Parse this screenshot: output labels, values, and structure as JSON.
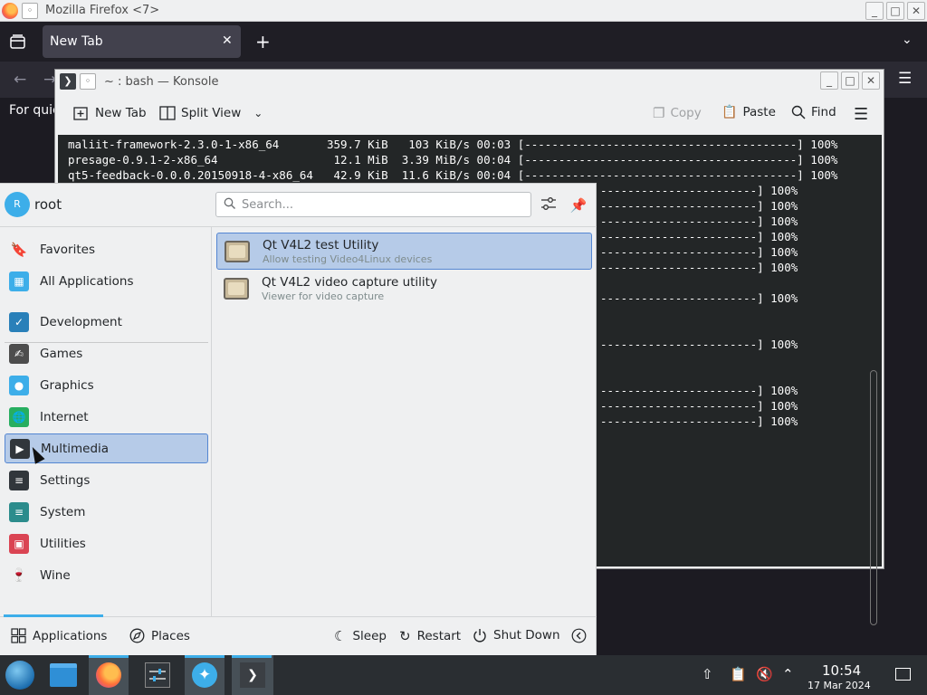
{
  "firefox": {
    "title": "Mozilla Firefox <7>",
    "tab_label": "New Tab",
    "quick_text": "For quic"
  },
  "konsole": {
    "title": "~ : bash — Konsole",
    "toolbar": {
      "new_tab": "New Tab",
      "split_view": "Split View",
      "copy": "Copy",
      "paste": "Paste",
      "find": "Find"
    },
    "lines": [
      "maliit-framework-2.3.0-1-x86_64       359.7 KiB   103 KiB/s 00:03 [----------------------------------------] 100%",
      "presage-0.9.1-2-x86_64                 12.1 MiB  3.39 MiB/s 00:04 [----------------------------------------] 100%",
      "qt5-feedback-0.0.0.20150918-4-x86_64   42.9 KiB  11.6 KiB/s 00:04 [----------------------------------------] 100%"
    ],
    "partial_lines": [
      {
        "row": 3,
        "text": "-----------------------] 100%"
      },
      {
        "row": 4,
        "text": "-----------------------] 100%"
      },
      {
        "row": 5,
        "text": "-----------------------] 100%"
      },
      {
        "row": 6,
        "text": "-----------------------] 100%"
      },
      {
        "row": 7,
        "text": "-----------------------] 100%"
      },
      {
        "row": 8,
        "text": "-----------------------] 100%"
      },
      {
        "row": 10,
        "text": "-----------------------] 100%"
      },
      {
        "row": 13,
        "text": "-----------------------] 100%"
      },
      {
        "row": 16,
        "text": "-----------------------] 100%"
      },
      {
        "row": 17,
        "text": "-----------------------] 100%"
      },
      {
        "row": 18,
        "text": "-----------------------] 100%"
      }
    ]
  },
  "launcher": {
    "user": "root",
    "avatar_letter": "R",
    "search_placeholder": "Search...",
    "categories": [
      {
        "label": "Favorites",
        "icon": "bookmark-icon"
      },
      {
        "label": "All Applications",
        "icon": "grid-icon"
      },
      {
        "label": "Development",
        "icon": "development-icon"
      },
      {
        "label": "Games",
        "icon": "gamepad-icon"
      },
      {
        "label": "Graphics",
        "icon": "graphics-icon"
      },
      {
        "label": "Internet",
        "icon": "globe-icon"
      },
      {
        "label": "Multimedia",
        "icon": "multimedia-icon",
        "selected": true
      },
      {
        "label": "Settings",
        "icon": "settings-icon"
      },
      {
        "label": "System",
        "icon": "system-icon"
      },
      {
        "label": "Utilities",
        "icon": "toolbox-icon"
      },
      {
        "label": "Wine",
        "icon": "wine-icon"
      }
    ],
    "apps": [
      {
        "name": "Qt V4L2 test Utility",
        "desc": "Allow testing Video4Linux devices",
        "selected": true
      },
      {
        "name": "Qt V4L2 video capture utility",
        "desc": "Viewer for video capture"
      }
    ],
    "footer": {
      "applications": "Applications",
      "places": "Places",
      "sleep": "Sleep",
      "restart": "Restart",
      "shutdown": "Shut Down"
    }
  },
  "taskbar": {
    "time": "10:54",
    "date": "17 Mar 2024"
  },
  "colors": {
    "accent": "#3daee9",
    "selection": "#b6cbe8",
    "terminal_bg": "#232627"
  }
}
